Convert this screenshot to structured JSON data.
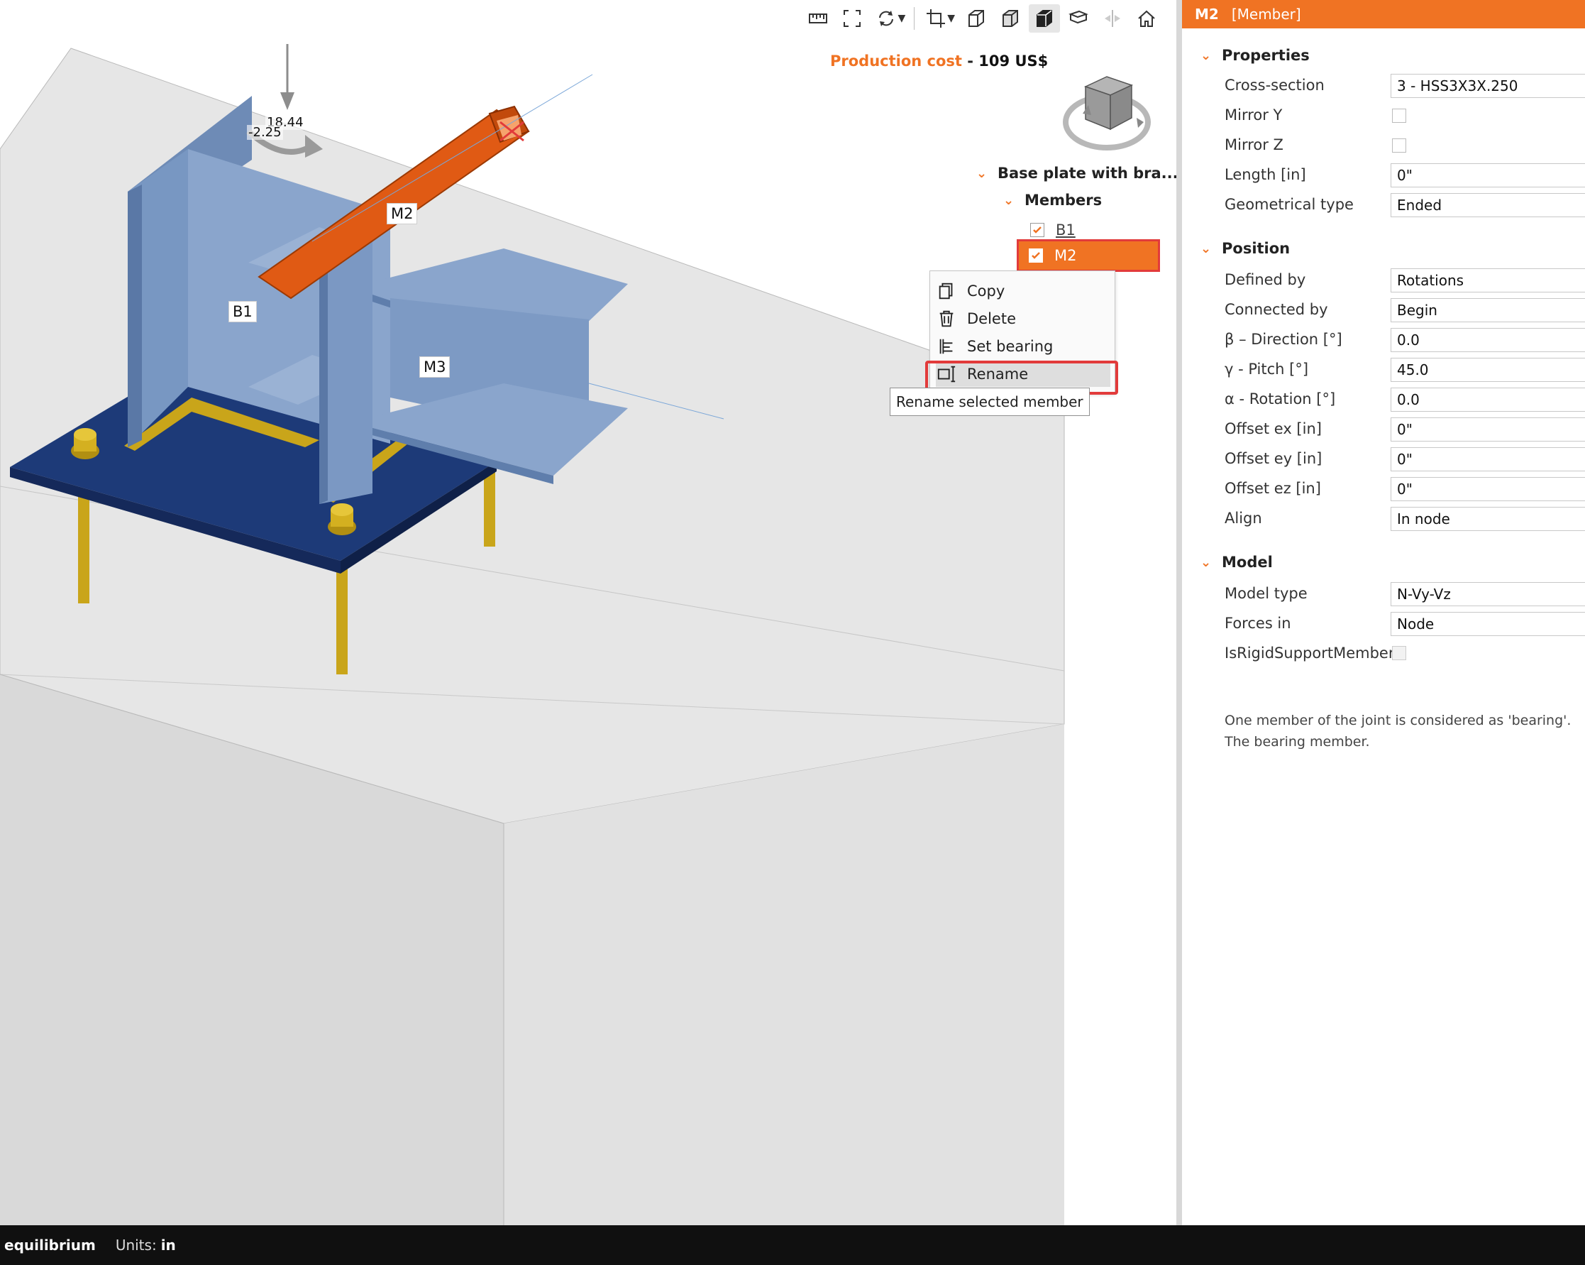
{
  "viewport": {
    "cost_label": "Production cost",
    "cost_sep": " - ",
    "cost_value": "109 US$",
    "load_values": [
      "18.44",
      "-2.25"
    ],
    "member_tags": [
      "M2",
      "B1",
      "M3"
    ]
  },
  "toolbar": {
    "icons": [
      "measure-icon",
      "fit-view-icon",
      "rotate-view-icon",
      "chevron-down-icon",
      "crop-icon",
      "chevron-down-icon",
      "wireframe-icon",
      "transparent-view-icon",
      "solid-view-icon",
      "section-view-icon",
      "symmetry-icon",
      "home-icon"
    ]
  },
  "tree": {
    "root": "Base plate with bra...",
    "members_label": "Members",
    "items": [
      {
        "label": "B1",
        "checked": true,
        "selected": false
      },
      {
        "label": "M2",
        "checked": true,
        "selected": true
      }
    ]
  },
  "context_menu": {
    "items": [
      {
        "label": "Copy",
        "icon": "copy-icon"
      },
      {
        "label": "Delete",
        "icon": "delete-icon"
      },
      {
        "label": "Set bearing",
        "icon": "bearing-icon"
      },
      {
        "label": "Rename",
        "icon": "rename-icon"
      }
    ],
    "tooltip": "Rename selected member"
  },
  "panel": {
    "title": "M2",
    "subtitle": "[Member]",
    "sections": {
      "properties": "Properties",
      "position": "Position",
      "model": "Model"
    },
    "properties": {
      "cross_section": {
        "label": "Cross-section",
        "value": "3 - HSS3X3X.250"
      },
      "mirror_y": {
        "label": "Mirror Y",
        "checked": false
      },
      "mirror_z": {
        "label": "Mirror Z",
        "checked": false
      },
      "length": {
        "label": "Length [in]",
        "value": "0\""
      },
      "geom_type": {
        "label": "Geometrical type",
        "value": "Ended"
      }
    },
    "position": {
      "defined_by": {
        "label": "Defined by",
        "value": "Rotations"
      },
      "connected_by": {
        "label": "Connected by",
        "value": "Begin"
      },
      "beta": {
        "label": "β – Direction [°]",
        "value": "0.0"
      },
      "gamma": {
        "label": "γ - Pitch [°]",
        "value": "45.0"
      },
      "alpha": {
        "label": "α - Rotation [°]",
        "value": "0.0"
      },
      "offset_ex": {
        "label": "Offset ex [in]",
        "value": "0\""
      },
      "offset_ey": {
        "label": "Offset ey [in]",
        "value": "0\""
      },
      "offset_ez": {
        "label": "Offset ez [in]",
        "value": "0\""
      },
      "align": {
        "label": "Align",
        "value": "In node"
      }
    },
    "model": {
      "model_type": {
        "label": "Model type",
        "value": "N-Vy-Vz"
      },
      "forces_in": {
        "label": "Forces in",
        "value": "Node"
      },
      "rigid_support": {
        "label": "IsRigidSupportMember",
        "checked": false
      }
    },
    "info_text": "One member of the joint is considered as 'bearing'. The bearing member."
  },
  "status": {
    "app": "equilibrium",
    "units_label": "Units:",
    "units_value": "in"
  },
  "colors": {
    "accent": "#f07323",
    "highlight": "#e23b3b",
    "steel": "#7f9cc4",
    "base_plate": "#1d3a78",
    "bolts": "#c9a51a"
  }
}
